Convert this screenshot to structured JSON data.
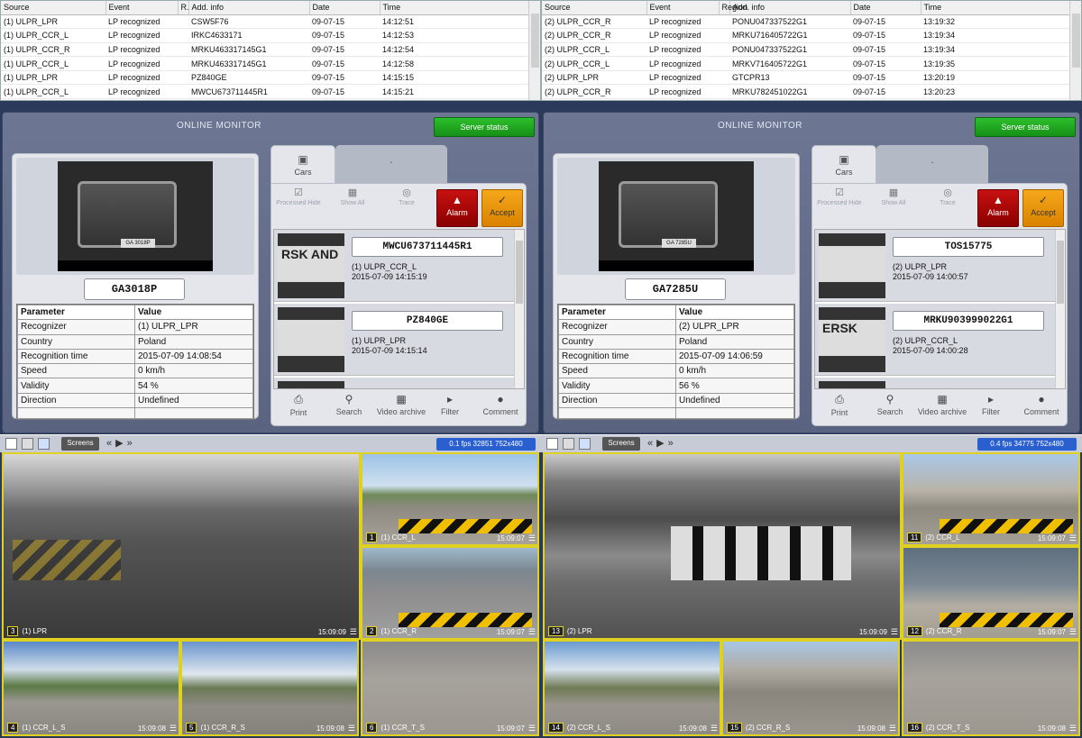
{
  "left": {
    "events": {
      "columns": [
        "Source",
        "Event",
        "R.",
        "Add. info",
        "Date",
        "Time"
      ],
      "rows": [
        [
          "(1) ULPR_LPR",
          "LP recognized",
          "",
          "CSW5F76",
          "09-07-15",
          "14:12:51"
        ],
        [
          "(1) ULPR_CCR_L",
          "LP recognized",
          "",
          "IRKC4633171",
          "09-07-15",
          "14:12:53"
        ],
        [
          "(1) ULPR_CCR_R",
          "LP recognized",
          "",
          "MRKU463317145G1",
          "09-07-15",
          "14:12:54"
        ],
        [
          "(1) ULPR_CCR_L",
          "LP recognized",
          "",
          "MRKU463317145G1",
          "09-07-15",
          "14:12:58"
        ],
        [
          "(1) ULPR_LPR",
          "LP recognized",
          "",
          "PZ840GE",
          "09-07-15",
          "14:15:15"
        ],
        [
          "(1) ULPR_CCR_L",
          "LP recognized",
          "",
          "MWCU673711445R1",
          "09-07-15",
          "14:15:21"
        ]
      ]
    },
    "monitor": {
      "title": "ONLINE MONITOR",
      "server_status": "Server status",
      "plate": "GA3018P",
      "photo_plate": "GA 3018P",
      "param_header": [
        "Parameter",
        "Value"
      ],
      "params": [
        [
          "Recognizer",
          "(1) ULPR_LPR"
        ],
        [
          "Country",
          "Poland"
        ],
        [
          "Recognition time",
          "2015-07-09 14:08:54"
        ],
        [
          "Speed",
          "0 km/h"
        ],
        [
          "Validity",
          "54 %"
        ],
        [
          "Direction",
          "Undefined"
        ]
      ],
      "tab_cars": "Cars",
      "tab_other": ".",
      "tools": {
        "processed": "Processed Hide",
        "show": "Show All",
        "trace": "Trace",
        "alarm": "Alarm",
        "accept": "Accept"
      },
      "list": [
        {
          "plate": "MWCU673711445R1",
          "source": "(1) ULPR_CCR_L",
          "time": "2015-07-09 14:15:19",
          "thumb_text": "RSK AND"
        },
        {
          "plate": "PZ840GE",
          "source": "(1) ULPR_LPR",
          "time": "2015-07-09 14:15:14",
          "thumb_text": ""
        }
      ],
      "bottom": {
        "print": "Print",
        "search": "Search",
        "video": "Video archive",
        "filter": "Filter",
        "comment": "Comment"
      }
    },
    "layout": {
      "screens": "Screens",
      "fps": "0.1 fps  32851 752x480"
    },
    "cams": [
      {
        "num": "3",
        "name": "(1) LPR",
        "time": "15:09:09"
      },
      {
        "num": "1",
        "name": "(1) CCR_L",
        "time": "15:09:07"
      },
      {
        "num": "2",
        "name": "(1) CCR_R",
        "time": "15:09:07"
      },
      {
        "num": "4",
        "name": "(1) CCR_L_S",
        "time": "15:09:08"
      },
      {
        "num": "5",
        "name": "(1) CCR_R_S",
        "time": "15:09:08"
      },
      {
        "num": "6",
        "name": "(1) CCR_T_S",
        "time": "15:09:07"
      }
    ]
  },
  "right": {
    "events": {
      "columns": [
        "Source",
        "Event",
        "Region",
        "Add. info",
        "Date",
        "Time"
      ],
      "rows": [
        [
          "(2) ULPR_CCR_R",
          "LP recognized",
          "",
          "PONU047337522G1",
          "09-07-15",
          "13:19:32"
        ],
        [
          "(2) ULPR_CCR_R",
          "LP recognized",
          "",
          "MRKU716405722G1",
          "09-07-15",
          "13:19:34"
        ],
        [
          "(2) ULPR_CCR_L",
          "LP recognized",
          "",
          "PONU047337522G1",
          "09-07-15",
          "13:19:34"
        ],
        [
          "(2) ULPR_CCR_L",
          "LP recognized",
          "",
          "MRKV716405722G1",
          "09-07-15",
          "13:19:35"
        ],
        [
          "(2) ULPR_LPR",
          "LP recognized",
          "",
          "GTCPR13",
          "09-07-15",
          "13:20:19"
        ],
        [
          "(2) ULPR_CCR_R",
          "LP recognized",
          "",
          "MRKU782451022G1",
          "09-07-15",
          "13:20:23"
        ]
      ]
    },
    "monitor": {
      "title": "ONLINE MONITOR",
      "server_status": "Server status",
      "plate": "GA7285U",
      "photo_plate": "GA 7285U",
      "param_header": [
        "Parameter",
        "Value"
      ],
      "params": [
        [
          "Recognizer",
          "(2) ULPR_LPR"
        ],
        [
          "Country",
          "Poland"
        ],
        [
          "Recognition time",
          "2015-07-09 14:06:59"
        ],
        [
          "Speed",
          "0 km/h"
        ],
        [
          "Validity",
          "56 %"
        ],
        [
          "Direction",
          "Undefined"
        ]
      ],
      "tab_cars": "Cars",
      "tab_other": ".",
      "tools": {
        "processed": "Processed Hide",
        "show": "Show All",
        "trace": "Trace",
        "alarm": "Alarm",
        "accept": "Accept"
      },
      "list": [
        {
          "plate": "TOS15775",
          "source": "(2) ULPR_LPR",
          "time": "2015-07-09 14:00:57",
          "thumb_text": ""
        },
        {
          "plate": "MRKU903999022G1",
          "source": "(2) ULPR_CCR_L",
          "time": "2015-07-09 14:00:28",
          "thumb_text": "ERSK"
        }
      ],
      "bottom": {
        "print": "Print",
        "search": "Search",
        "video": "Video archive",
        "filter": "Filter",
        "comment": "Comment"
      }
    },
    "layout": {
      "screens": "Screens",
      "fps": "0.4 fps  34775 752x480"
    },
    "cams": [
      {
        "num": "13",
        "name": "(2) LPR",
        "time": "15:09:09"
      },
      {
        "num": "11",
        "name": "(2) CCR_L",
        "time": "15:09:07"
      },
      {
        "num": "12",
        "name": "(2) CCR_R",
        "time": "15:09:07"
      },
      {
        "num": "14",
        "name": "(2) CCR_L_S",
        "time": "15:09:08"
      },
      {
        "num": "15",
        "name": "(2) CCR_R_S",
        "time": "15:09:08"
      },
      {
        "num": "16",
        "name": "(2) CCR_T_S",
        "time": "15:09:08"
      }
    ]
  },
  "colors": {
    "camera_border": "#e0d020",
    "server_status": "#1fa51f",
    "alarm": "#b00000",
    "accept": "#f0a010",
    "fps_badge": "#2a5fd0"
  },
  "icons": [
    "monitor-icon",
    "checkbox-icon",
    "grid-icon",
    "target-icon",
    "bell-icon",
    "check-icon",
    "printer-icon",
    "magnifier-icon",
    "film-icon",
    "filter-icon",
    "speech-bubble-icon",
    "menu-icon",
    "chevron-double-left-icon",
    "play-icon",
    "chevron-double-right-icon"
  ]
}
